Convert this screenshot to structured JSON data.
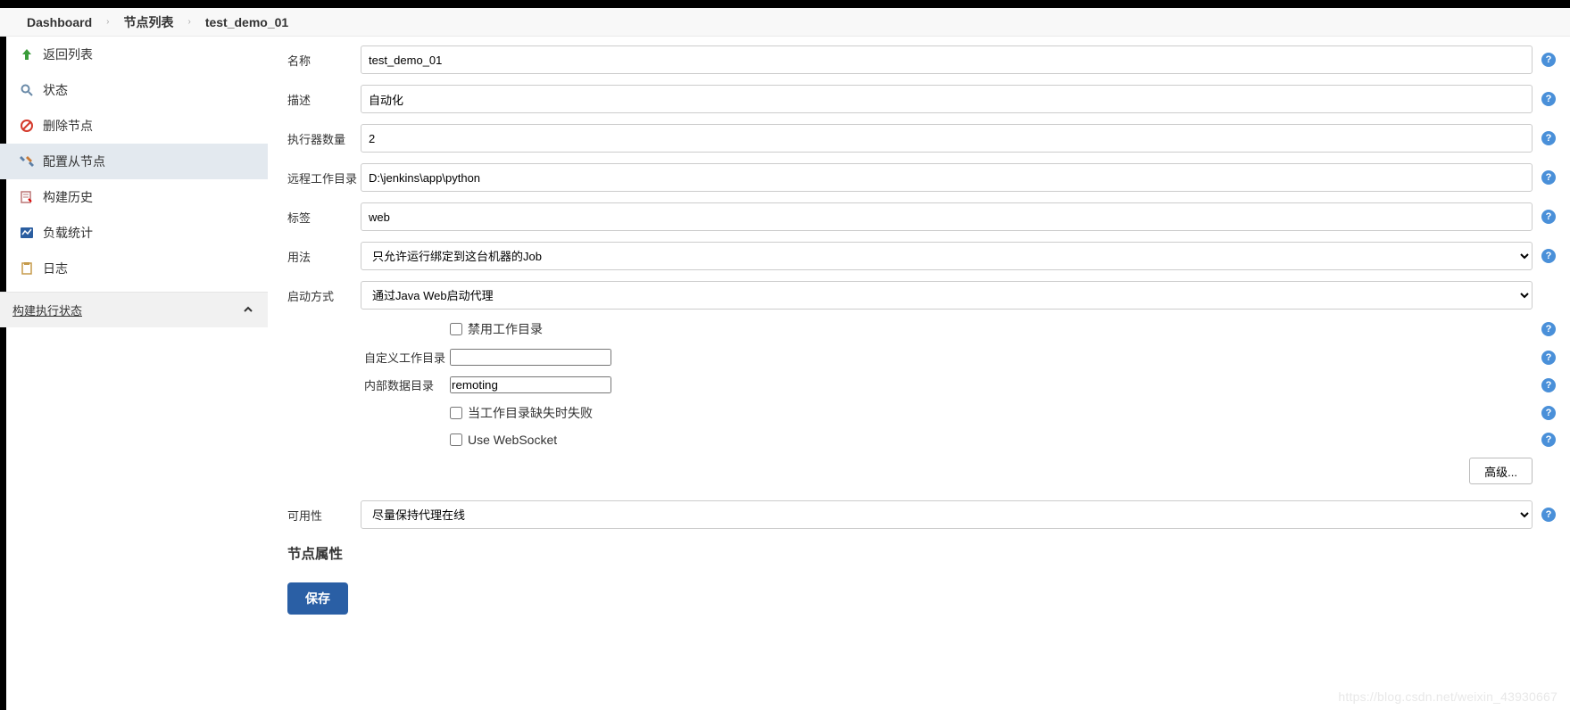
{
  "breadcrumb": {
    "dashboard": "Dashboard",
    "nodeList": "节点列表",
    "nodeName": "test_demo_01"
  },
  "sidebar": {
    "back": "返回列表",
    "status": "状态",
    "delete": "删除节点",
    "configure": "配置从节点",
    "buildHistory": "构建历史",
    "loadStats": "负载统计",
    "log": "日志",
    "buildExecStatus": "构建执行状态"
  },
  "form": {
    "nameLabel": "名称",
    "nameValue": "test_demo_01",
    "descLabel": "描述",
    "descValue": "自动化",
    "executorsLabel": "执行器数量",
    "executorsValue": "2",
    "remoteFsLabel": "远程工作目录",
    "remoteFsValue": "D:\\jenkins\\app\\python",
    "labelsLabel": "标签",
    "labelsValue": "web",
    "usageLabel": "用法",
    "usageOption": "只允许运行绑定到这台机器的Job",
    "launchLabel": "启动方式",
    "launchOption": "通过Java Web启动代理",
    "disableWorkdir": "禁用工作目录",
    "customWorkdirLabel": "自定义工作目录",
    "customWorkdirValue": "",
    "internalDirLabel": "内部数据目录",
    "internalDirValue": "remoting",
    "failIfMissing": "当工作目录缺失时失败",
    "useWebSocket": "Use WebSocket",
    "advancedBtn": "高级...",
    "availabilityLabel": "可用性",
    "availabilityOption": "尽量保持代理在线",
    "nodeProps": "节点属性",
    "saveBtn": "保存"
  },
  "icons": {
    "help": "?"
  },
  "watermark": "https://blog.csdn.net/weixin_43930667"
}
